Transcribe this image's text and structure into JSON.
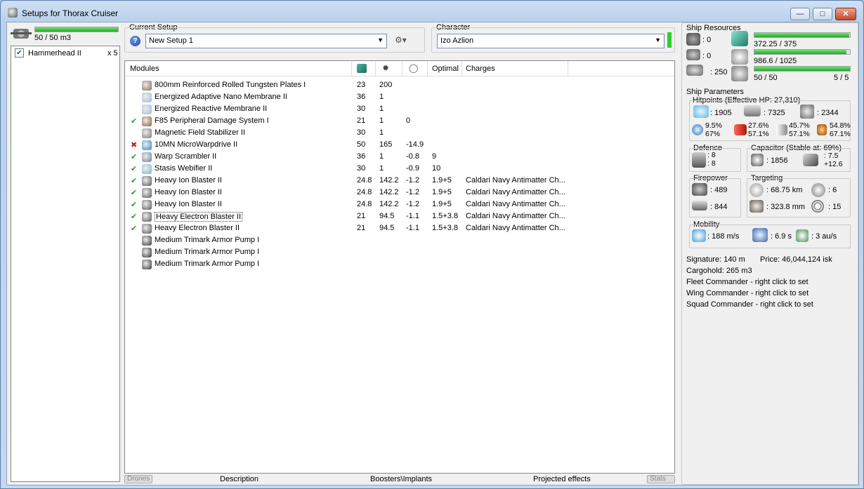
{
  "window": {
    "title": "Setups for Thorax Cruiser"
  },
  "drones_bay": {
    "capacity": "50 / 50 m3",
    "fill_fraction": 1.0
  },
  "drone_list": [
    {
      "checked": true,
      "name": "Hammerhead II",
      "count": "x 5"
    }
  ],
  "current_setup": {
    "label": "Current Setup",
    "value": "New Setup 1"
  },
  "character": {
    "label": "Character",
    "value": "Izo Azlion"
  },
  "modules_table": {
    "headers": [
      "Modules",
      "",
      "",
      "",
      "Optimal",
      "Charges"
    ],
    "rows": [
      {
        "status": "",
        "name": "800mm Reinforced Rolled Tungsten Plates I",
        "cpu": "23",
        "pg": "200",
        "cap": "",
        "optimal": "",
        "charges": ""
      },
      {
        "status": "",
        "name": "Energized Adaptive Nano Membrane II",
        "cpu": "36",
        "pg": "1",
        "cap": "",
        "optimal": "",
        "charges": ""
      },
      {
        "status": "",
        "name": "Energized Reactive Membrane II",
        "cpu": "30",
        "pg": "1",
        "cap": "",
        "optimal": "",
        "charges": ""
      },
      {
        "status": "✔",
        "name": "F85 Peripheral Damage System I",
        "cpu": "21",
        "pg": "1",
        "cap": "0",
        "optimal": "",
        "charges": ""
      },
      {
        "status": "",
        "name": "Magnetic Field Stabilizer II",
        "cpu": "30",
        "pg": "1",
        "cap": "",
        "optimal": "",
        "charges": ""
      },
      {
        "status": "✖",
        "name": "10MN MicroWarpdrive II",
        "cpu": "50",
        "pg": "165",
        "cap": "-14.9",
        "optimal": "",
        "charges": ""
      },
      {
        "status": "✔",
        "name": "Warp Scrambler II",
        "cpu": "36",
        "pg": "1",
        "cap": "-0.8",
        "optimal": "9",
        "charges": ""
      },
      {
        "status": "✔",
        "name": "Stasis Webifier II",
        "cpu": "30",
        "pg": "1",
        "cap": "-0.9",
        "optimal": "10",
        "charges": ""
      },
      {
        "status": "✔",
        "name": "Heavy Ion Blaster II",
        "cpu": "24.8",
        "pg": "142.2",
        "cap": "-1.2",
        "optimal": "1.9+5",
        "charges": "Caldari Navy Antimatter Ch..."
      },
      {
        "status": "✔",
        "name": "Heavy Ion Blaster II",
        "cpu": "24.8",
        "pg": "142.2",
        "cap": "-1.2",
        "optimal": "1.9+5",
        "charges": "Caldari Navy Antimatter Ch..."
      },
      {
        "status": "✔",
        "name": "Heavy Ion Blaster II",
        "cpu": "24.8",
        "pg": "142.2",
        "cap": "-1.2",
        "optimal": "1.9+5",
        "charges": "Caldari Navy Antimatter Ch..."
      },
      {
        "status": "✔",
        "name": "Heavy Electron Blaster II",
        "cpu": "21",
        "pg": "94.5",
        "cap": "-1.1",
        "optimal": "1.5+3.8",
        "charges": "Caldari Navy Antimatter Ch..."
      },
      {
        "status": "✔",
        "name": "Heavy Electron Blaster II",
        "cpu": "21",
        "pg": "94.5",
        "cap": "-1.1",
        "optimal": "1.5+3.8",
        "charges": "Caldari Navy Antimatter Ch..."
      },
      {
        "status": "",
        "name": "Medium Trimark Armor Pump I",
        "cpu": "",
        "pg": "",
        "cap": "",
        "optimal": "",
        "charges": ""
      },
      {
        "status": "",
        "name": "Medium Trimark Armor Pump I",
        "cpu": "",
        "pg": "",
        "cap": "",
        "optimal": "",
        "charges": ""
      },
      {
        "status": "",
        "name": "Medium Trimark Armor Pump I",
        "cpu": "",
        "pg": "",
        "cap": "",
        "optimal": "",
        "charges": ""
      }
    ]
  },
  "bottom_tabs": {
    "drones": "Drones",
    "description": "Description",
    "boosters": "Boosters\\Implants",
    "projected": "Projected effects",
    "stats": "Stats"
  },
  "ship_resources": {
    "label": "Ship Resources",
    "hardpoints": {
      "turret": ": 0",
      "launcher": ": 0",
      "calibration": ": 250"
    },
    "cpu": {
      "text": "372.25 / 375",
      "fraction": 0.99
    },
    "powergrid": {
      "text": "986.6 / 1025",
      "fraction": 0.96
    },
    "drone_bandwidth": {
      "text": "50 / 50",
      "fraction": 1.0
    },
    "drones_active": "5 / 5"
  },
  "ship_parameters": {
    "label": "Ship Parameters",
    "hitpoints_label": "Hitpoints (Effective HP: 27,310)",
    "shield_hp": ": 1905",
    "armor_hp": ": 7325",
    "structure_hp": ": 2344",
    "resists": [
      {
        "a": "9.5%",
        "b": "67%"
      },
      {
        "a": "27.6%",
        "b": "57.1%"
      },
      {
        "a": "45.7%",
        "b": "57.1%"
      },
      {
        "a": "54.8%",
        "b": "67.1%"
      }
    ],
    "defence_label": "Defence",
    "defence_a": ": 8",
    "defence_b": ": 8",
    "capacitor_label": "Capacitor (Stable at: 69%)",
    "capacitor_amount": ": 1856",
    "capacitor_delta_a": ": 7.5",
    "capacitor_delta_b": "+12.6",
    "firepower_label": "Firepower",
    "firepower_a": ": 489",
    "firepower_b": ": 844",
    "targeting_label": "Targeting",
    "targeting_range": ": 68.75 km",
    "targeting_targets": ": 6",
    "targeting_sensor": ": 323.8 mm",
    "targeting_res": ": 15",
    "mobility_label": "Mobility",
    "speed": ": 188 m/s",
    "align": ": 6.9 s",
    "warp": ": 3 au/s",
    "signature": "Signature: 140 m",
    "price": "Price: 46,044,124 isk",
    "cargohold": "Cargohold: 265 m3",
    "fleet_cmd": "Fleet Commander - right click to set",
    "wing_cmd": "Wing Commander - right click to set",
    "squad_cmd": "Squad Commander - right click to set"
  },
  "colors": {
    "bar_green": "#22a922",
    "ok_check": "#2aa02a",
    "error_x": "#c02020"
  }
}
